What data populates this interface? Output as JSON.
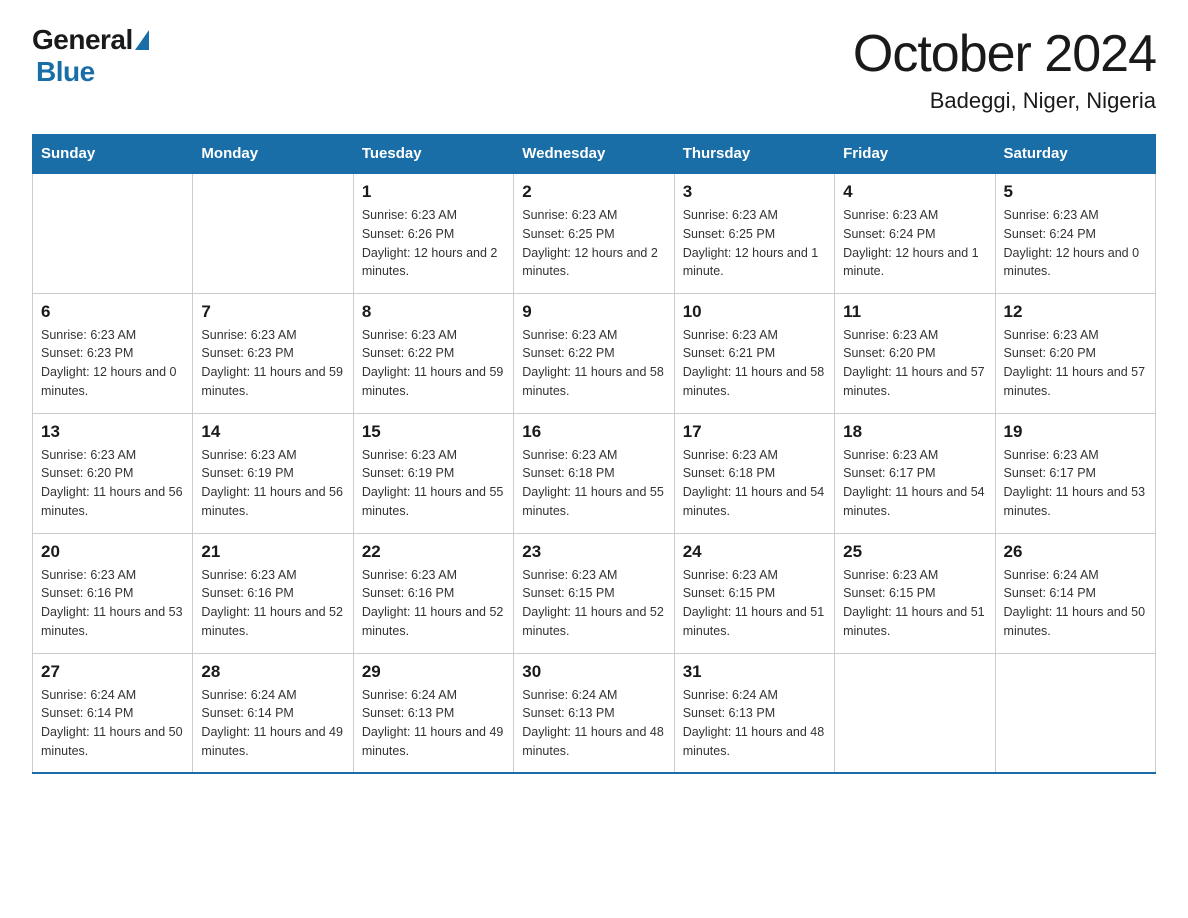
{
  "logo": {
    "general": "General",
    "blue": "Blue"
  },
  "header": {
    "title": "October 2024",
    "subtitle": "Badeggi, Niger, Nigeria"
  },
  "weekdays": [
    "Sunday",
    "Monday",
    "Tuesday",
    "Wednesday",
    "Thursday",
    "Friday",
    "Saturday"
  ],
  "weeks": [
    [
      {
        "day": "",
        "sunrise": "",
        "sunset": "",
        "daylight": ""
      },
      {
        "day": "",
        "sunrise": "",
        "sunset": "",
        "daylight": ""
      },
      {
        "day": "1",
        "sunrise": "Sunrise: 6:23 AM",
        "sunset": "Sunset: 6:26 PM",
        "daylight": "Daylight: 12 hours and 2 minutes."
      },
      {
        "day": "2",
        "sunrise": "Sunrise: 6:23 AM",
        "sunset": "Sunset: 6:25 PM",
        "daylight": "Daylight: 12 hours and 2 minutes."
      },
      {
        "day": "3",
        "sunrise": "Sunrise: 6:23 AM",
        "sunset": "Sunset: 6:25 PM",
        "daylight": "Daylight: 12 hours and 1 minute."
      },
      {
        "day": "4",
        "sunrise": "Sunrise: 6:23 AM",
        "sunset": "Sunset: 6:24 PM",
        "daylight": "Daylight: 12 hours and 1 minute."
      },
      {
        "day": "5",
        "sunrise": "Sunrise: 6:23 AM",
        "sunset": "Sunset: 6:24 PM",
        "daylight": "Daylight: 12 hours and 0 minutes."
      }
    ],
    [
      {
        "day": "6",
        "sunrise": "Sunrise: 6:23 AM",
        "sunset": "Sunset: 6:23 PM",
        "daylight": "Daylight: 12 hours and 0 minutes."
      },
      {
        "day": "7",
        "sunrise": "Sunrise: 6:23 AM",
        "sunset": "Sunset: 6:23 PM",
        "daylight": "Daylight: 11 hours and 59 minutes."
      },
      {
        "day": "8",
        "sunrise": "Sunrise: 6:23 AM",
        "sunset": "Sunset: 6:22 PM",
        "daylight": "Daylight: 11 hours and 59 minutes."
      },
      {
        "day": "9",
        "sunrise": "Sunrise: 6:23 AM",
        "sunset": "Sunset: 6:22 PM",
        "daylight": "Daylight: 11 hours and 58 minutes."
      },
      {
        "day": "10",
        "sunrise": "Sunrise: 6:23 AM",
        "sunset": "Sunset: 6:21 PM",
        "daylight": "Daylight: 11 hours and 58 minutes."
      },
      {
        "day": "11",
        "sunrise": "Sunrise: 6:23 AM",
        "sunset": "Sunset: 6:20 PM",
        "daylight": "Daylight: 11 hours and 57 minutes."
      },
      {
        "day": "12",
        "sunrise": "Sunrise: 6:23 AM",
        "sunset": "Sunset: 6:20 PM",
        "daylight": "Daylight: 11 hours and 57 minutes."
      }
    ],
    [
      {
        "day": "13",
        "sunrise": "Sunrise: 6:23 AM",
        "sunset": "Sunset: 6:20 PM",
        "daylight": "Daylight: 11 hours and 56 minutes."
      },
      {
        "day": "14",
        "sunrise": "Sunrise: 6:23 AM",
        "sunset": "Sunset: 6:19 PM",
        "daylight": "Daylight: 11 hours and 56 minutes."
      },
      {
        "day": "15",
        "sunrise": "Sunrise: 6:23 AM",
        "sunset": "Sunset: 6:19 PM",
        "daylight": "Daylight: 11 hours and 55 minutes."
      },
      {
        "day": "16",
        "sunrise": "Sunrise: 6:23 AM",
        "sunset": "Sunset: 6:18 PM",
        "daylight": "Daylight: 11 hours and 55 minutes."
      },
      {
        "day": "17",
        "sunrise": "Sunrise: 6:23 AM",
        "sunset": "Sunset: 6:18 PM",
        "daylight": "Daylight: 11 hours and 54 minutes."
      },
      {
        "day": "18",
        "sunrise": "Sunrise: 6:23 AM",
        "sunset": "Sunset: 6:17 PM",
        "daylight": "Daylight: 11 hours and 54 minutes."
      },
      {
        "day": "19",
        "sunrise": "Sunrise: 6:23 AM",
        "sunset": "Sunset: 6:17 PM",
        "daylight": "Daylight: 11 hours and 53 minutes."
      }
    ],
    [
      {
        "day": "20",
        "sunrise": "Sunrise: 6:23 AM",
        "sunset": "Sunset: 6:16 PM",
        "daylight": "Daylight: 11 hours and 53 minutes."
      },
      {
        "day": "21",
        "sunrise": "Sunrise: 6:23 AM",
        "sunset": "Sunset: 6:16 PM",
        "daylight": "Daylight: 11 hours and 52 minutes."
      },
      {
        "day": "22",
        "sunrise": "Sunrise: 6:23 AM",
        "sunset": "Sunset: 6:16 PM",
        "daylight": "Daylight: 11 hours and 52 minutes."
      },
      {
        "day": "23",
        "sunrise": "Sunrise: 6:23 AM",
        "sunset": "Sunset: 6:15 PM",
        "daylight": "Daylight: 11 hours and 52 minutes."
      },
      {
        "day": "24",
        "sunrise": "Sunrise: 6:23 AM",
        "sunset": "Sunset: 6:15 PM",
        "daylight": "Daylight: 11 hours and 51 minutes."
      },
      {
        "day": "25",
        "sunrise": "Sunrise: 6:23 AM",
        "sunset": "Sunset: 6:15 PM",
        "daylight": "Daylight: 11 hours and 51 minutes."
      },
      {
        "day": "26",
        "sunrise": "Sunrise: 6:24 AM",
        "sunset": "Sunset: 6:14 PM",
        "daylight": "Daylight: 11 hours and 50 minutes."
      }
    ],
    [
      {
        "day": "27",
        "sunrise": "Sunrise: 6:24 AM",
        "sunset": "Sunset: 6:14 PM",
        "daylight": "Daylight: 11 hours and 50 minutes."
      },
      {
        "day": "28",
        "sunrise": "Sunrise: 6:24 AM",
        "sunset": "Sunset: 6:14 PM",
        "daylight": "Daylight: 11 hours and 49 minutes."
      },
      {
        "day": "29",
        "sunrise": "Sunrise: 6:24 AM",
        "sunset": "Sunset: 6:13 PM",
        "daylight": "Daylight: 11 hours and 49 minutes."
      },
      {
        "day": "30",
        "sunrise": "Sunrise: 6:24 AM",
        "sunset": "Sunset: 6:13 PM",
        "daylight": "Daylight: 11 hours and 48 minutes."
      },
      {
        "day": "31",
        "sunrise": "Sunrise: 6:24 AM",
        "sunset": "Sunset: 6:13 PM",
        "daylight": "Daylight: 11 hours and 48 minutes."
      },
      {
        "day": "",
        "sunrise": "",
        "sunset": "",
        "daylight": ""
      },
      {
        "day": "",
        "sunrise": "",
        "sunset": "",
        "daylight": ""
      }
    ]
  ]
}
